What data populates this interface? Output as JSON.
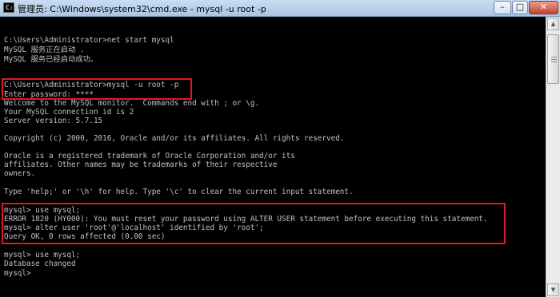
{
  "window": {
    "title": "管理员: C:\\Windows\\system32\\cmd.exe - mysql  -u root -p",
    "icon_text": "C:\\",
    "minimize_label": "–",
    "maximize_label": "□",
    "close_label": "✕"
  },
  "console": {
    "lines": [
      "",
      "C:\\Users\\Administrator>net start mysql",
      "MySQL 服务正在启动 .",
      "MySQL 服务已经启动成功。",
      "",
      "",
      "C:\\Users\\Administrator>mysql -u root -p",
      "Enter password: ****",
      "Welcome to the MySQL monitor.  Commands end with ; or \\g.",
      "Your MySQL connection id is 2",
      "Server version: 5.7.15",
      "",
      "Copyright (c) 2000, 2016, Oracle and/or its affiliates. All rights reserved.",
      "",
      "Oracle is a registered trademark of Oracle Corporation and/or its",
      "affiliates. Other names may be trademarks of their respective",
      "owners.",
      "",
      "Type 'help;' or '\\h' for help. Type '\\c' to clear the current input statement.",
      "",
      "mysql> use mysql;",
      "ERROR 1820 (HY000): You must reset your password using ALTER USER statement before executing this statement.",
      "mysql> alter user 'root'@'localhost' identified by 'root';",
      "Query OK, 0 rows affected (0.00 sec)",
      "",
      "mysql> use mysql;",
      "Database changed",
      "mysql>"
    ]
  },
  "colors": {
    "console_background": "#000000",
    "console_text": "#c0c0c0",
    "highlight_border": "#e0191f"
  },
  "icons": [
    "cmd-app-icon",
    "minimize-icon",
    "maximize-icon",
    "close-icon",
    "scroll-up-icon",
    "scroll-down-icon"
  ]
}
